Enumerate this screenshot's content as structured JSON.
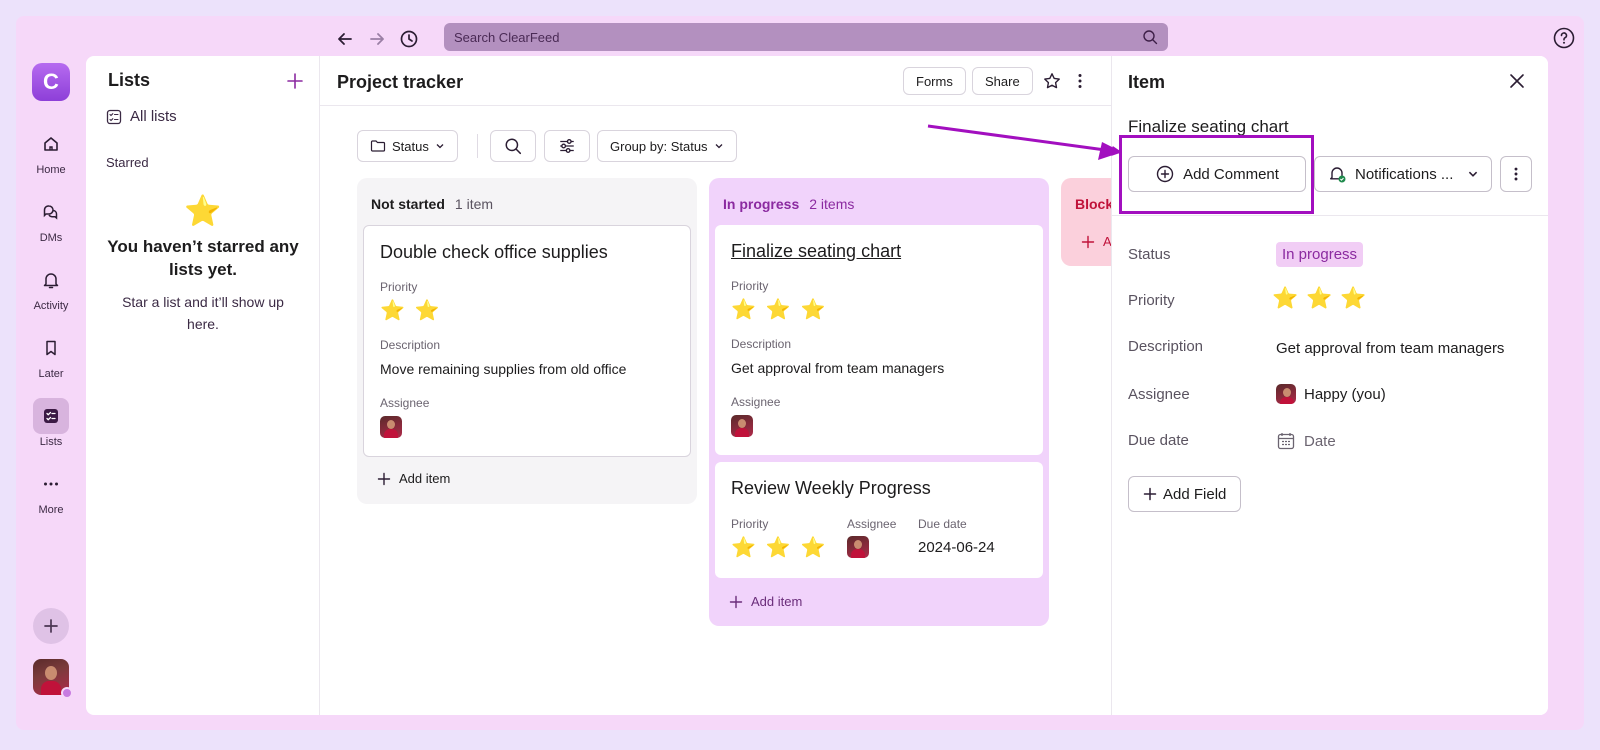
{
  "topbar": {
    "search_placeholder": "Search ClearFeed"
  },
  "rail": {
    "logo": "C",
    "items": [
      {
        "label": "Home"
      },
      {
        "label": "DMs"
      },
      {
        "label": "Activity"
      },
      {
        "label": "Later"
      },
      {
        "label": "Lists"
      },
      {
        "label": "More"
      }
    ]
  },
  "lists_sidebar": {
    "title": "Lists",
    "all_lists": "All lists",
    "starred": "Starred",
    "empty_title": "You haven’t starred any lists yet.",
    "empty_sub": "Star a list and it’ll show up here."
  },
  "project": {
    "title": "Project tracker",
    "forms_label": "Forms",
    "share_label": "Share",
    "toolbar": {
      "status_filter": "Status",
      "group_by": "Group by: Status"
    },
    "columns": [
      {
        "name": "Not started",
        "count": "1 item",
        "add_item": "Add item",
        "cards": [
          {
            "title": "Double check office supplies",
            "priority_label": "Priority",
            "priority": 2,
            "description_label": "Description",
            "description": "Move remaining supplies from old office",
            "assignee_label": "Assignee"
          }
        ]
      },
      {
        "name": "In progress",
        "count": "2 items",
        "add_item": "Add item",
        "cards": [
          {
            "title": "Finalize seating chart",
            "priority_label": "Priority",
            "priority": 3,
            "description_label": "Description",
            "description": "Get approval from team managers",
            "assignee_label": "Assignee"
          },
          {
            "title": "Review Weekly Progress",
            "priority_label": "Priority",
            "priority": 3,
            "assignee_label": "Assignee",
            "due_label": "Due date",
            "due": "2024-06-24"
          }
        ]
      },
      {
        "name": "Block",
        "add_item": "A"
      }
    ]
  },
  "detail": {
    "title": "Item",
    "item_name": "Finalize seating chart",
    "add_comment": "Add Comment",
    "notifications": "Notifications ...",
    "fields": {
      "status_label": "Status",
      "status": "In progress",
      "priority_label": "Priority",
      "priority": 3,
      "description_label": "Description",
      "description": "Get approval from team managers",
      "assignee_label": "Assignee",
      "assignee": "Happy (you)",
      "due_label": "Due date",
      "due_placeholder": "Date"
    },
    "add_field": "Add Field"
  },
  "colors": {
    "accent": "#a20fbf",
    "in_progress_bg": "#f1d3fb",
    "blocked_bg": "#fbd0dc"
  }
}
